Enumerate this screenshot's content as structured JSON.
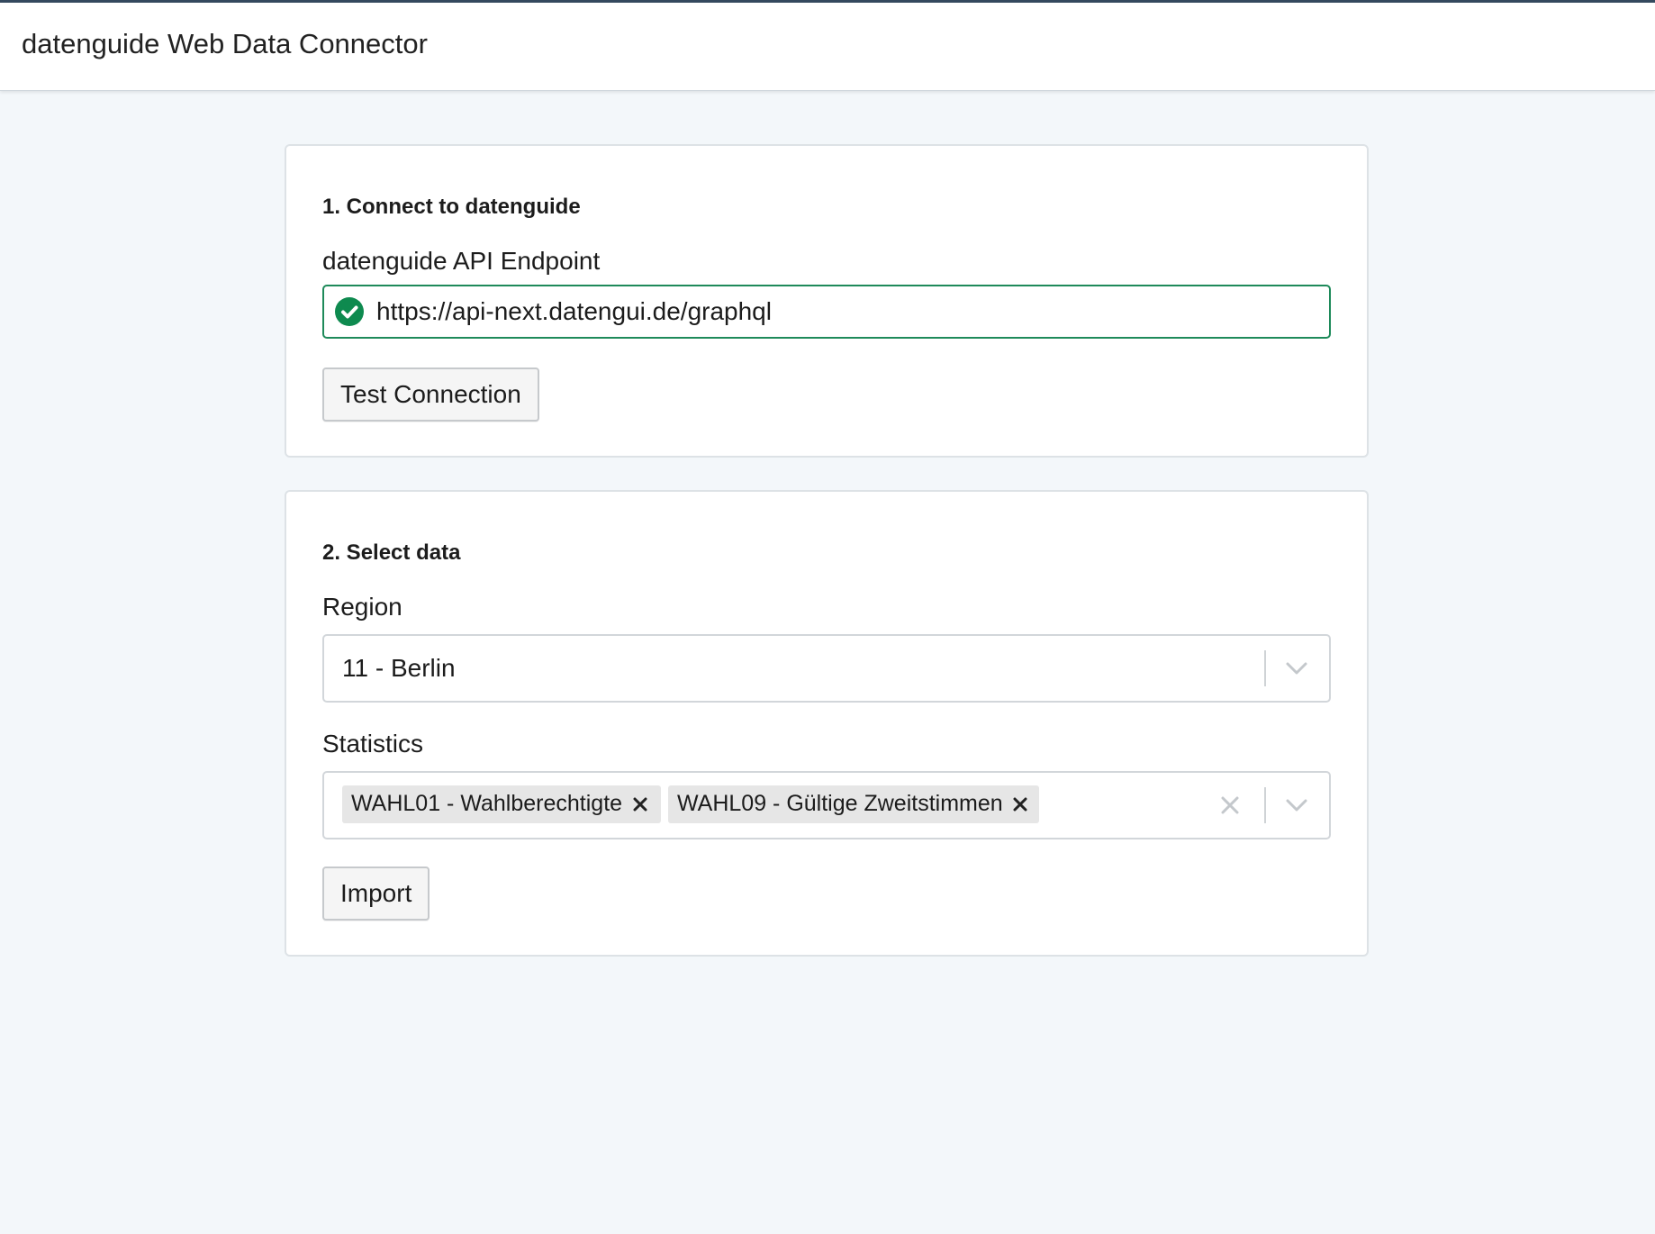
{
  "header": {
    "title": "datenguide Web Data Connector"
  },
  "connect": {
    "title": "1. Connect to datenguide",
    "endpoint_label": "datenguide API Endpoint",
    "endpoint_value": "https://api-next.datengui.de/graphql",
    "endpoint_status_icon": "check-circle-icon",
    "test_button": "Test Connection"
  },
  "select": {
    "title": "2. Select data",
    "region_label": "Region",
    "region_value": "11 - Berlin",
    "statistics_label": "Statistics",
    "statistics_tags": [
      "WAHL01 - Wahlberechtigte",
      "WAHL09 - Gültige Zweitstimmen"
    ],
    "import_button": "Import"
  },
  "colors": {
    "valid_border": "#1e8a5a",
    "check_fill": "#0e8a4f",
    "page_background": "#f3f7fa"
  }
}
